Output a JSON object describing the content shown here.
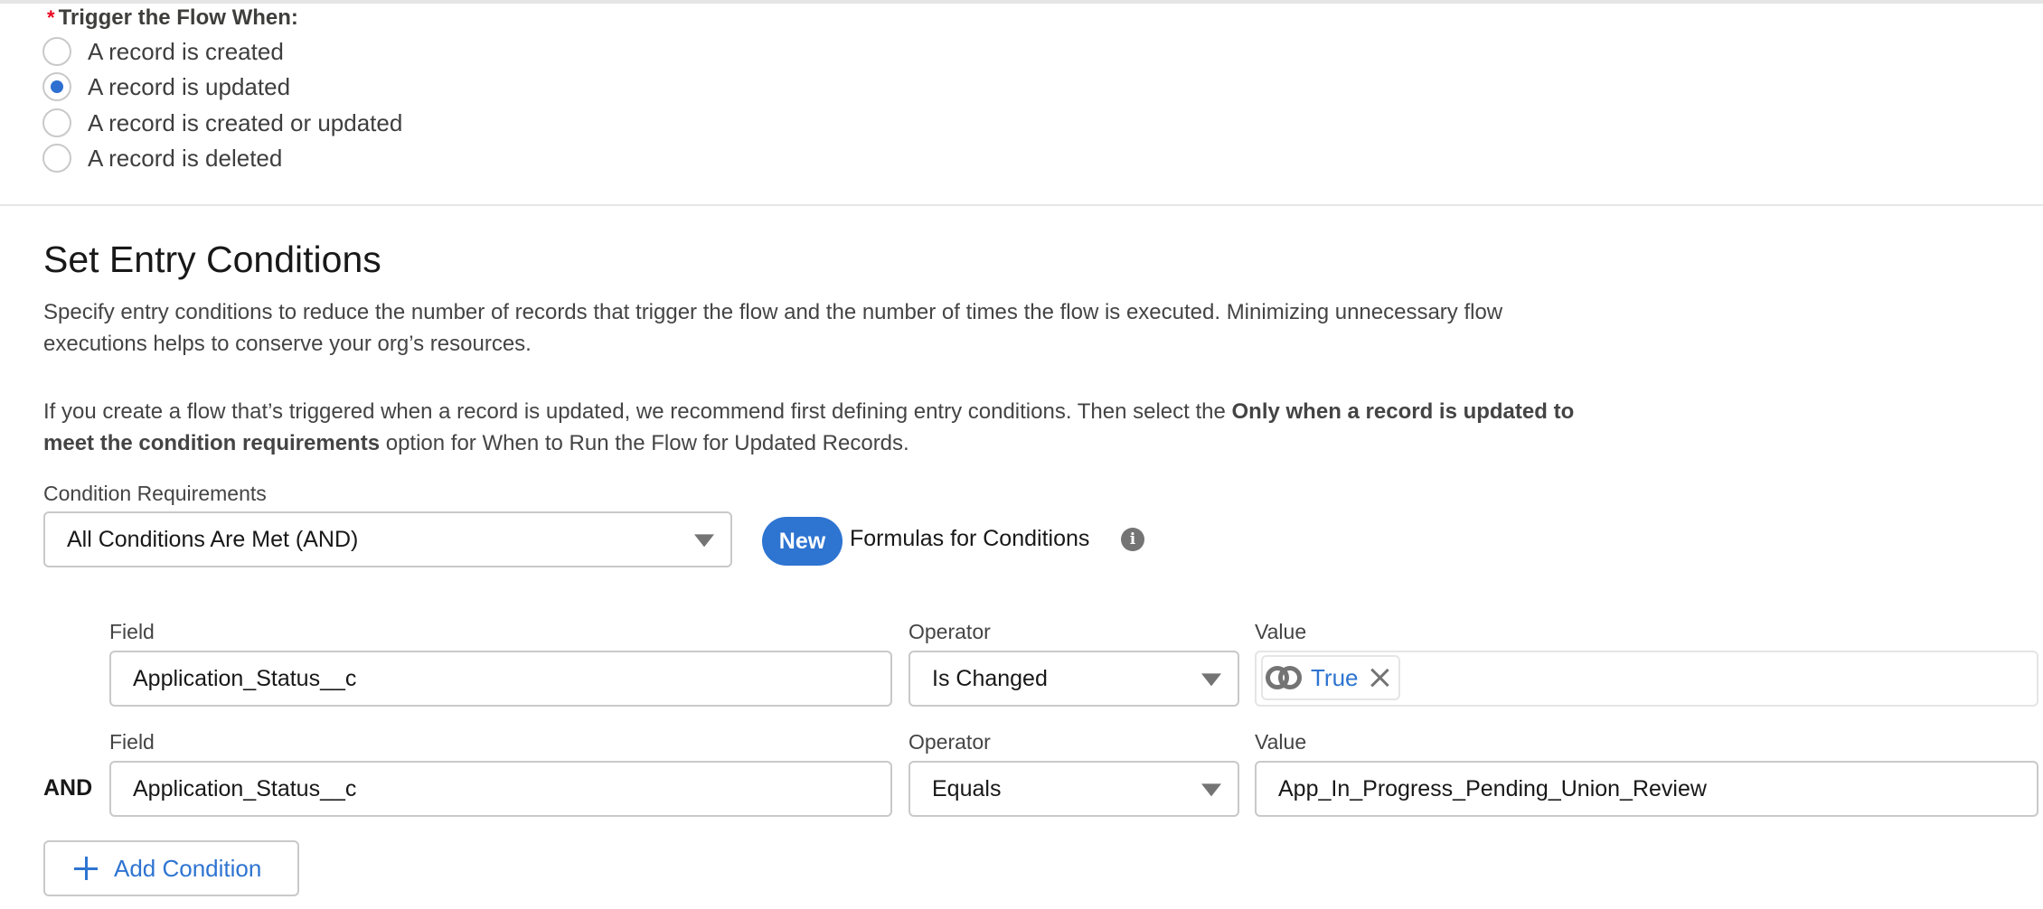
{
  "trigger": {
    "required_marker": "*",
    "label": "Trigger the Flow When:",
    "options": [
      {
        "label": "A record is created",
        "checked": false
      },
      {
        "label": "A record is updated",
        "checked": true
      },
      {
        "label": "A record is created or updated",
        "checked": false
      },
      {
        "label": "A record is deleted",
        "checked": false
      }
    ]
  },
  "entry_conditions": {
    "title": "Set Entry Conditions",
    "paragraph1": "Specify entry conditions to reduce the number of records that trigger the flow and the number of times the flow is executed. Minimizing unnecessary flow executions helps to conserve your org’s resources.",
    "paragraph2_before": "If you create a flow that’s triggered when a record is updated, we recommend first defining entry conditions. Then select the ",
    "paragraph2_bold": "Only when a record is updated to meet the condition requirements",
    "paragraph2_after": " option for When to Run the Flow for Updated Records.",
    "condition_requirements_label": "Condition Requirements",
    "condition_requirements_value": "All Conditions Are Met (AND)",
    "new_badge": "New",
    "formulas_label": "Formulas for Conditions",
    "info_icon": "info-icon"
  },
  "conditions": [
    {
      "connector": "",
      "field_label": "Field",
      "field_value": "Application_Status__c",
      "operator_label": "Operator",
      "operator_value": "Is Changed",
      "value_label": "Value",
      "value_pill": {
        "icon": "boolean-rings-icon",
        "text": "True"
      }
    },
    {
      "connector": "AND",
      "field_label": "Field",
      "field_value": "Application_Status__c",
      "operator_label": "Operator",
      "operator_value": "Equals",
      "value_label": "Value",
      "value_text": "App_In_Progress_Pending_Union_Review"
    }
  ],
  "add_condition_label": "Add Condition",
  "colors": {
    "accent": "#2e74d1",
    "required": "#ea001e",
    "border": "#c9c9c9",
    "text": "#181818",
    "muted_text": "#444444"
  }
}
